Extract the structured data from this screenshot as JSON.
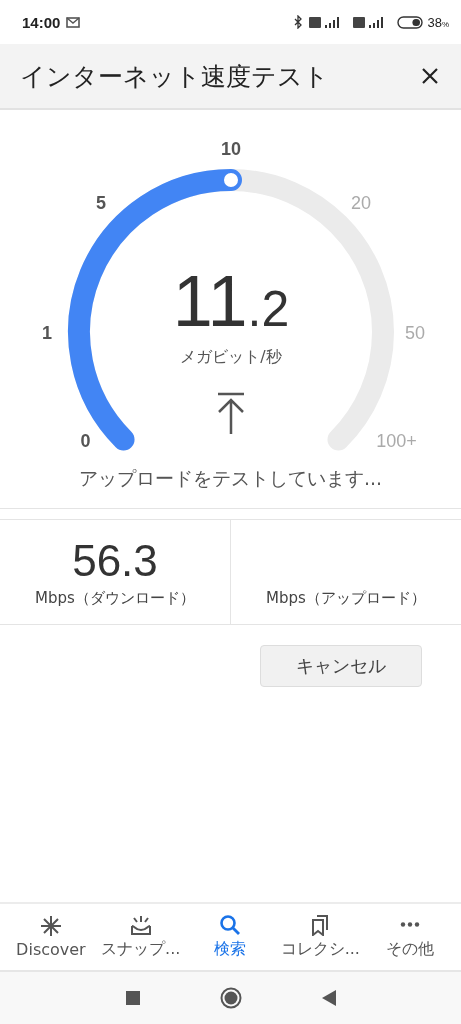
{
  "status_bar": {
    "time": "14:00",
    "battery": "38$_{%}$"
  },
  "app_bar": {
    "title": "インターネット速度テスト"
  },
  "gauge": {
    "ticks": [
      "0",
      "1",
      "5",
      "10",
      "20",
      "50",
      "100+"
    ],
    "value_whole": "11",
    "value_fraction": ".2",
    "unit": "メガビット/秒",
    "status": "アップロードをテストしています..."
  },
  "results": [
    {
      "value": "56.3",
      "label": "Mbps（ダウンロード）"
    },
    {
      "label": "Mbps（アップロード）"
    }
  ],
  "cancel_button": "キャンセル",
  "bottom_nav": [
    {
      "kind": "asterisk",
      "label": "Discover",
      "selected": false
    },
    {
      "kind": "snap",
      "label": "スナップ...",
      "selected": false
    },
    {
      "kind": "search",
      "label": "検索",
      "selected": true
    },
    {
      "kind": "collection",
      "label": "コレクシ...",
      "selected": false
    },
    {
      "kind": "more",
      "label": "その他",
      "selected": false
    }
  ]
}
